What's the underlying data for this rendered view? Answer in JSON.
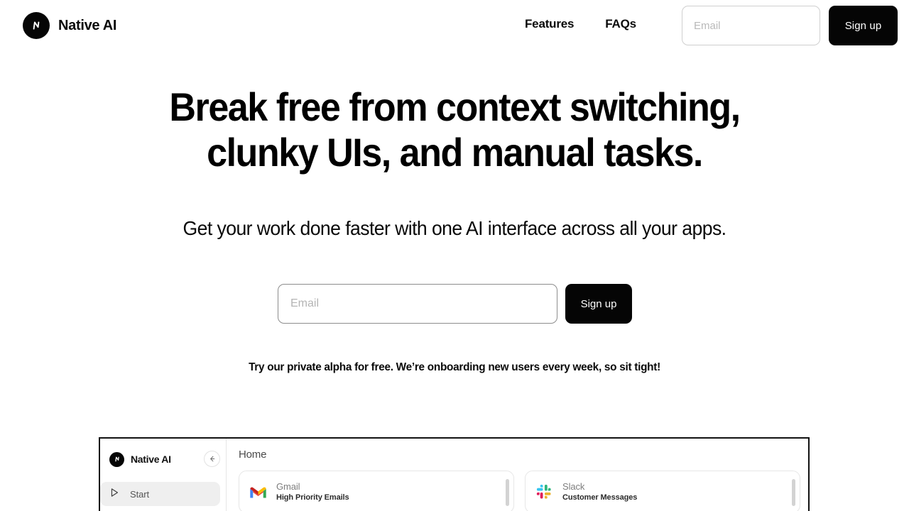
{
  "brand": {
    "name": "Native AI",
    "logo_icon": "native-ai-logo-icon",
    "logo_bg": "#050505"
  },
  "nav": {
    "links": [
      {
        "label": "Features",
        "name": "features"
      },
      {
        "label": "FAQs",
        "name": "faqs"
      }
    ],
    "email": {
      "value": "",
      "placeholder": "Email"
    },
    "signup_label": "Sign up",
    "signup_bg": "#050505"
  },
  "hero": {
    "headline_line1": "Break free from context switching,",
    "headline_line2": "clunky UIs, and manual tasks.",
    "subhead": "Get your work done faster with one AI interface across all your apps.",
    "email": {
      "value": "",
      "placeholder": "Email"
    },
    "signup_label": "Sign up",
    "alpha_note": "Try our private alpha for free. We’re onboarding new users every week, so sit tight!"
  },
  "app_preview": {
    "brand_name": "Native AI",
    "back_icon": "arrow-left-icon",
    "sidebar_items": [
      {
        "label": "Start",
        "icon": "play-icon",
        "active": true
      }
    ],
    "breadcrumb": "Home",
    "cards": [
      {
        "title": "Gmail",
        "subtitle": "High Priority Emails",
        "icon": "gmail-icon"
      },
      {
        "title": "Slack",
        "subtitle": "Customer Messages",
        "icon": "slack-icon"
      }
    ]
  },
  "colors": {
    "accent": "#050505",
    "background": "#ffffff",
    "input_border_nav": "#cfcfcf",
    "input_border_hero": "#8d8d8d",
    "placeholder": "#b9b9b9"
  }
}
